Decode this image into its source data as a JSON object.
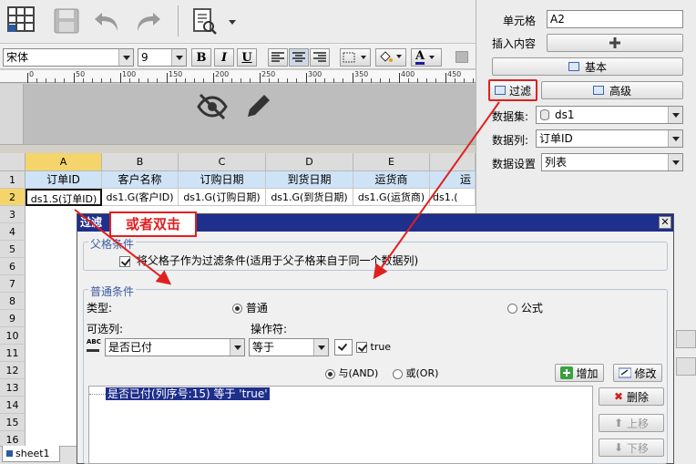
{
  "toolbar": {
    "font_name": "宋体",
    "font_size": "9",
    "bold": "B",
    "italic": "I",
    "underline": "U",
    "text_color_glyph": "A"
  },
  "ruler_ticks": [
    "0",
    "50",
    "100",
    "150",
    "200",
    "250",
    "300",
    "350",
    "400",
    "450"
  ],
  "sheet": {
    "columns": [
      "A",
      "B",
      "C",
      "D",
      "E"
    ],
    "rows": [
      "1",
      "2",
      "3",
      "4",
      "5",
      "6",
      "7",
      "8",
      "9",
      "10",
      "11",
      "12",
      "13",
      "14",
      "15",
      "16"
    ],
    "headers": [
      "订单ID",
      "客户名称",
      "订购日期",
      "到货日期",
      "运货商",
      "运"
    ],
    "data_row": [
      "ds1.S(订单ID)",
      "ds1.G(客户ID)",
      "ds1.G(订购日期)",
      "ds1.G(到货日期)",
      "ds1.G(运货商)",
      "ds1.("
    ],
    "tab": "sheet1"
  },
  "panel": {
    "cell_label": "单元格",
    "cell_value": "A2",
    "insert_label": "插入内容",
    "basic_button": "基本",
    "filter_button": "过滤",
    "advanced_button": "高级",
    "dataset_label": "数据集:",
    "dataset_value": "ds1",
    "column_label": "数据列:",
    "column_value": "订单ID",
    "setting_label": "数据设置",
    "setting_value": "列表"
  },
  "callout": "或者双击",
  "dialog": {
    "title": "过滤",
    "parent_legend": "父格条件",
    "parent_checkbox": "将父格子作为过滤条件(适用于父子格来自于同一个数据列)",
    "normal_legend": "普通条件",
    "type_label": "类型:",
    "type_normal": "普通",
    "type_formula": "公式",
    "optional_col_label": "可选列:",
    "operator_label": "操作符:",
    "optional_col_value": "是否已付",
    "operator_value": "等于",
    "value_text": "true",
    "and_label": "与(AND)",
    "or_label": "或(OR)",
    "add_button": "增加",
    "modify_button": "修改",
    "delete_button": "删除",
    "up_button": "上移",
    "down_button": "下移",
    "condition_item": "是否已付(列序号:15) 等于 'true'"
  },
  "colors": {
    "accent_red": "#e02020",
    "selection_blue": "#1e2f8c"
  }
}
